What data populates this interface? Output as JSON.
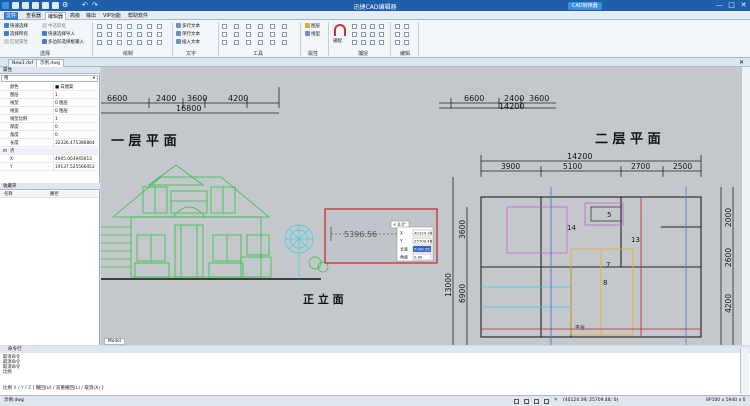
{
  "window": {
    "title": "迅捷CAD编辑器",
    "badge": "CAD转换器",
    "minimize": "—",
    "restore": "□",
    "close": "✕"
  },
  "menu": [
    "文件",
    "查看器",
    "编辑器",
    "高级",
    "输出",
    "VIP功能",
    "帮助软件"
  ],
  "ribbon": {
    "select": [
      "快速选择",
      "选择所有",
      "匹配属性"
    ],
    "select2": [
      "中选取框",
      "快速选择导入",
      "多边形选择框输入"
    ],
    "groups": {
      "select": "选择",
      "draw": "绘制",
      "text": "文字",
      "tools": "工具",
      "props": "属性",
      "snap": "捕捉",
      "edit": "编辑"
    },
    "text": [
      "多行文本",
      "单行文本",
      "插入文本"
    ],
    "props": [
      "图层",
      "线型"
    ],
    "snap_btn": "捕捉"
  },
  "tabs": [
    "New1.dxf",
    "示例.dwg"
  ],
  "properties": {
    "header": "属性",
    "filter": "线",
    "rows": [
      {
        "k": "颜色",
        "v": "■ 白图案"
      },
      {
        "k": "图层",
        "v": "1"
      },
      {
        "k": "线型",
        "v": "0 图层"
      },
      {
        "k": "线宽",
        "v": "0 图层"
      },
      {
        "k": "线型比例",
        "v": "1"
      },
      {
        "k": "厚度",
        "v": "0"
      },
      {
        "k": "角度",
        "v": "0"
      },
      {
        "k": "长度",
        "v": "32326.475386864"
      }
    ],
    "point_section": "点",
    "x_label": "X",
    "x_value": "4905.003945613",
    "y_label": "Y",
    "y_value": "19137.525566453"
  },
  "favorites": {
    "header": "收藏夹",
    "col_name": "名称",
    "col_path": "路径"
  },
  "drawing": {
    "title_first_floor": "一 层 平 面",
    "title_second_floor": "二 层 平 面",
    "title_elevation": "正 立 面",
    "dims_top_left": [
      "6600",
      "2400",
      "3600",
      "4200"
    ],
    "dim_total_left": "16800",
    "dims_top_right": [
      "6600",
      "2400",
      "3600"
    ],
    "dim_total_right": "14200",
    "plan_total": "14200",
    "plan_dims": [
      "3900",
      "5100",
      "2700",
      "2500"
    ],
    "side_dims": [
      "13000",
      "3600",
      "6900",
      "2000",
      "2600",
      "4200"
    ],
    "room_numbers": [
      "5",
      "14",
      "13",
      "7",
      "8"
    ],
    "plan_label": "平台",
    "measure_value": "5396.56",
    "input_hint": "< 0.0°",
    "inputs": [
      {
        "label": "X",
        "value": "40124.39"
      },
      {
        "label": "Y",
        "value": "25709.48"
      },
      {
        "label": "长度",
        "value": "5396.56"
      },
      {
        "label": "角度",
        "value": "0.00"
      }
    ]
  },
  "model_tab": "Model",
  "command": {
    "header": "命令行",
    "history": [
      "取消命令",
      "取消命令",
      "取消命令",
      "比例"
    ],
    "prompt_prefix": "比例 ",
    "prompt_options": [
      "X",
      "Y",
      "Z"
    ],
    "prompt_rest": "[ 撤回(U) / 双重撤回(L) / 取消(X) ]:"
  },
  "status": {
    "file": "示例.dwg",
    "coords": "(40124.39; 25709.48; 0)",
    "size": "8P100 x 5940 x 0"
  },
  "colors": {
    "accent": "#1f5ea8",
    "highlight": "#cc2222",
    "drawing_bg": "#c4c8cc"
  }
}
